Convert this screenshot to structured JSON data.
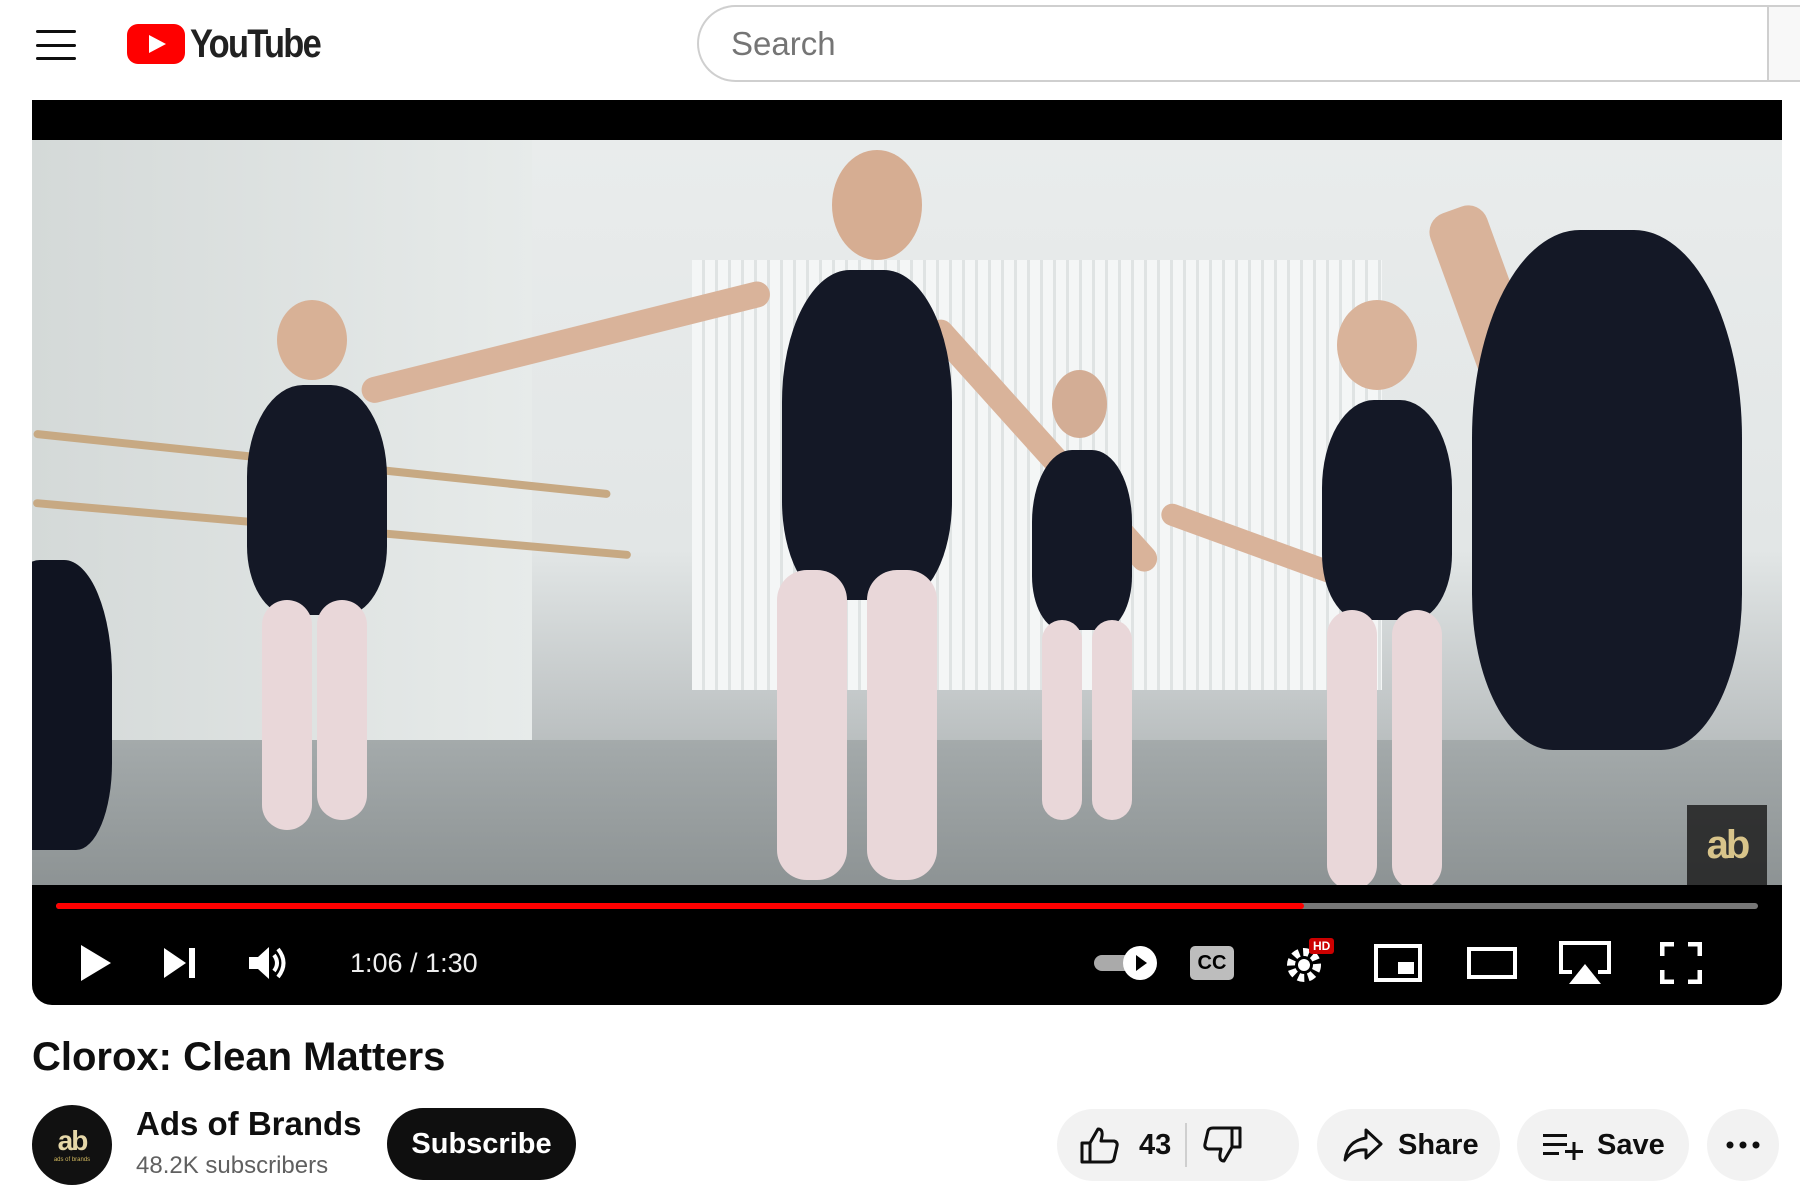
{
  "header": {
    "logo_text": "YouTube",
    "search_placeholder": "Search"
  },
  "player": {
    "current_time": "1:06",
    "duration": "1:30",
    "time_display": "1:06 / 1:30",
    "progress_fraction": 0.733,
    "watermark": "ab",
    "settings_badge": "HD",
    "cc_label": "CC",
    "colors": {
      "progress_played": "#ff0000",
      "progress_track": "#777777",
      "badge": "#cc0000"
    }
  },
  "video": {
    "title": "Clorox: Clean Matters"
  },
  "channel": {
    "name": "Ads of Brands",
    "subscribers": "48.2K subscribers",
    "avatar_mark": "ab",
    "avatar_sub": "ads of brands"
  },
  "actions": {
    "subscribe_label": "Subscribe",
    "like_count": "43",
    "share_label": "Share",
    "save_label": "Save"
  }
}
